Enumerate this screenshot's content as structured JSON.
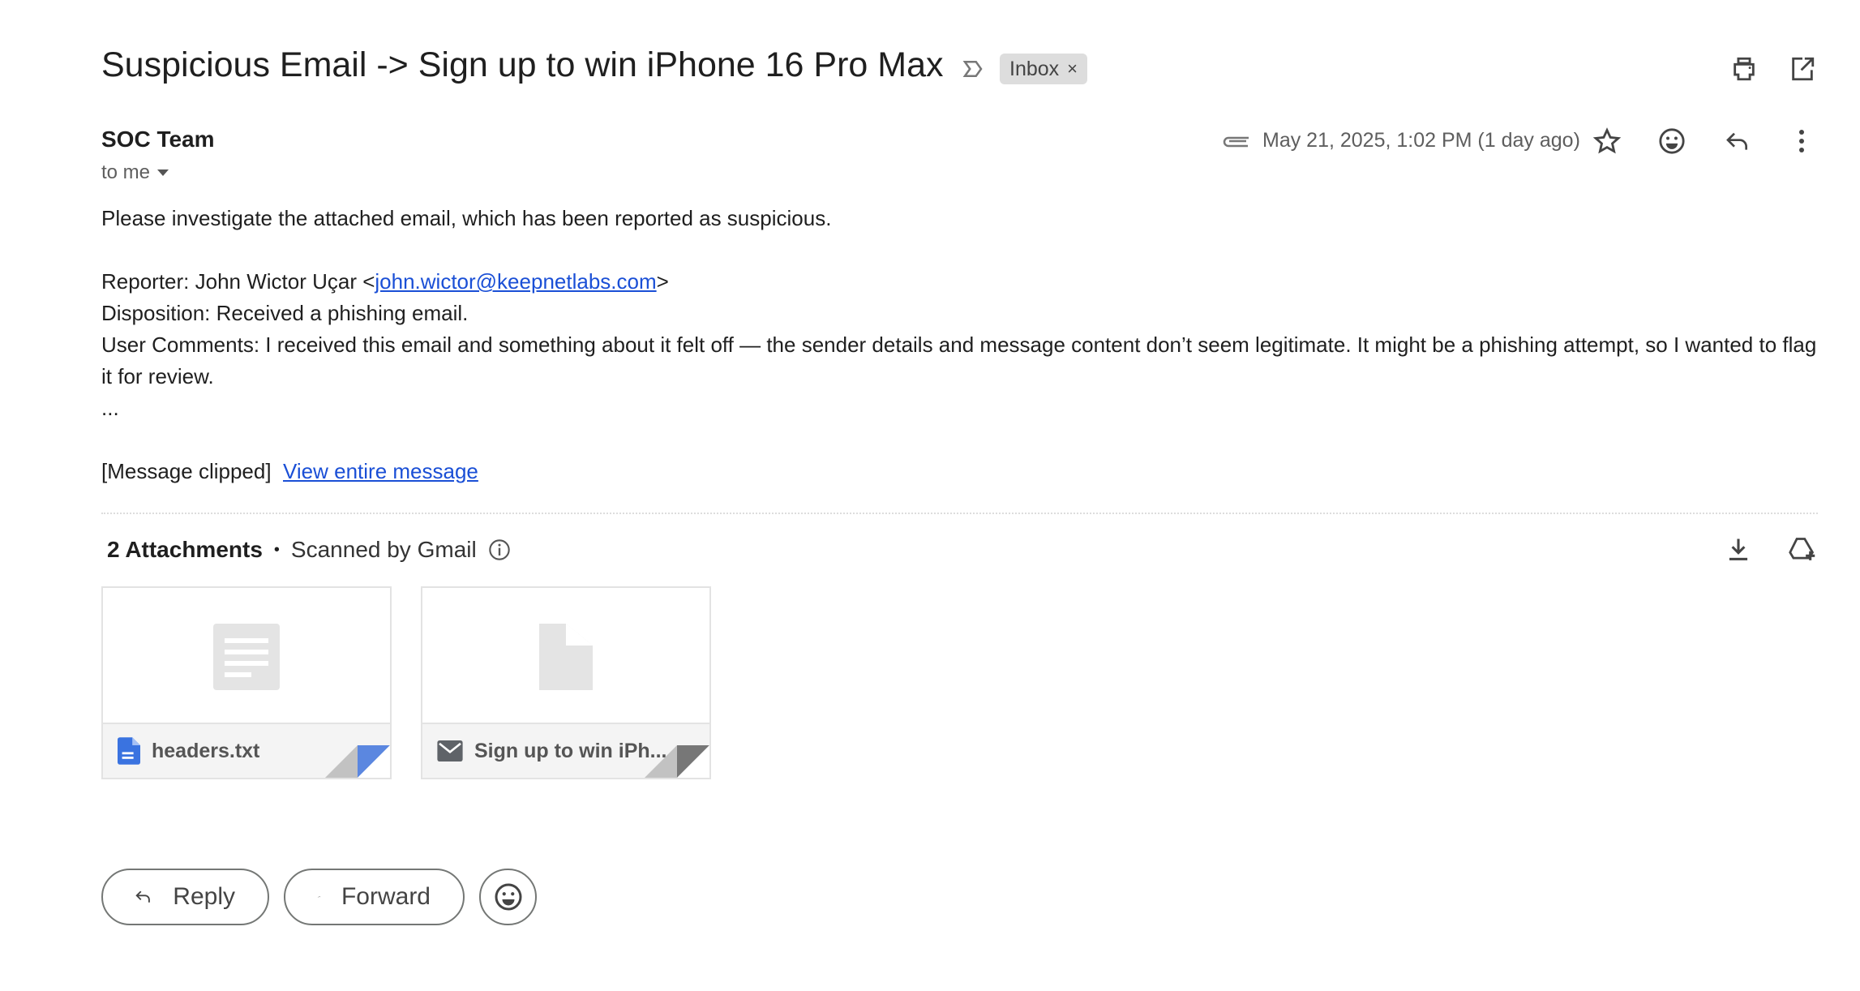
{
  "email": {
    "subject": "Suspicious Email -> Sign up to win iPhone 16 Pro Max",
    "label_chip": "Inbox",
    "label_remove": "×",
    "sender": "SOC Team",
    "recipient": "to me",
    "date": "May 21, 2025, 1:02 PM (1 day ago)",
    "body": {
      "intro": "Please investigate the attached email, which has been reported as suspicious.",
      "reporter_prefix": "Reporter: John Wictor Uçar <",
      "reporter_email": "john.wictor@keepnetlabs.com",
      "reporter_suffix": ">",
      "disposition": "Disposition: Received a phishing email.",
      "comments": "User Comments: I received this email and something about it felt off — the sender details and message content don’t seem legitimate. It might be a phishing attempt, so I wanted to flag it for review.",
      "ellipsis": "...",
      "clipped": "[Message clipped]",
      "view_entire": "View entire message"
    }
  },
  "attachments": {
    "count_label": "2 Attachments",
    "separator": "•",
    "scanned": "Scanned by Gmail",
    "items": [
      {
        "name": "headers.txt",
        "icon": "google-docs-icon",
        "corner_color": "#5b87e0"
      },
      {
        "name": "Sign up to win iPh...",
        "icon": "email-icon",
        "corner_color": "#777777"
      }
    ]
  },
  "actions": {
    "reply": "Reply",
    "forward": "Forward"
  },
  "colors": {
    "link": "#1a4fd6",
    "doc_blue": "#3a73e0"
  }
}
